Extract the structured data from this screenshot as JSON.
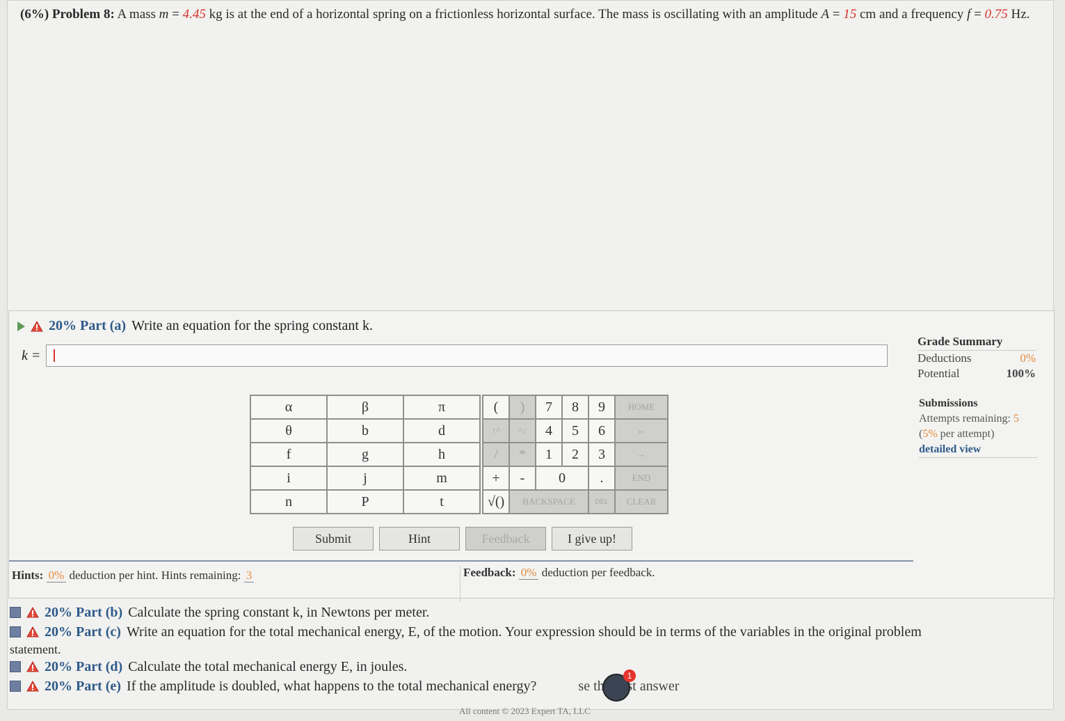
{
  "problem": {
    "prefix": "(6%) Problem 8:",
    "text1": " A mass ",
    "m_var": "m",
    "eq1": " = ",
    "m_val": "4.45",
    "text2": " kg is at the end of a horizontal spring on a frictionless horizontal surface. The mass is oscillating with an amplitude ",
    "A_var": "A",
    "eq2": " = ",
    "A_val": "15",
    "text3": " cm and a frequency ",
    "f_var": "f",
    "eq3": " = ",
    "f_val": "0.75",
    "text4": " Hz."
  },
  "part_a": {
    "pct": "20% Part (a)",
    "text": "Write an equation for the spring constant k.",
    "input_label": "k ="
  },
  "grade_summary": {
    "title": "Grade Summary",
    "deductions_label": "Deductions",
    "deductions_value": "0%",
    "potential_label": "Potential",
    "potential_value": "100%"
  },
  "submissions": {
    "title": "Submissions",
    "attempts_label": "Attempts remaining:",
    "attempts_value": "5",
    "per_attempt_pct": "5%",
    "per_attempt_text": "per attempt)",
    "detailed_view": "detailed view"
  },
  "symbols": [
    [
      "α",
      "β",
      "π"
    ],
    [
      "θ",
      "b",
      "d"
    ],
    [
      "f",
      "g",
      "h"
    ],
    [
      "i",
      "j",
      "m"
    ],
    [
      "n",
      "P",
      "t"
    ]
  ],
  "keypad": {
    "r1": [
      "(",
      ")",
      "7",
      "8",
      "9",
      "HOME"
    ],
    "r2": [
      "↑^",
      "^↓",
      "4",
      "5",
      "6",
      "←"
    ],
    "r3": [
      "/",
      "*",
      "1",
      "2",
      "3",
      "→"
    ],
    "r4": [
      "+",
      "-",
      "0",
      ".",
      "END"
    ],
    "r5": [
      "√()",
      "BACKSPACE",
      "DEL",
      "CLEAR"
    ]
  },
  "buttons": {
    "submit": "Submit",
    "hint": "Hint",
    "feedback": "Feedback",
    "give_up": "I give up!"
  },
  "hints": {
    "label": "Hints:",
    "pct": "0%",
    "text": "deduction per hint. Hints remaining:",
    "remaining": "3"
  },
  "feedback": {
    "label": "Feedback:",
    "pct": "0%",
    "text": "deduction per feedback."
  },
  "other_parts": [
    {
      "pct": "20% Part (b)",
      "text": "Calculate the spring constant k, in Newtons per meter."
    },
    {
      "pct": "20% Part (c)",
      "text": "Write an equation for the total mechanical energy, E, of the motion. Your expression should be in terms of the variables in the original problem"
    },
    {
      "pct": "20% Part (d)",
      "text": "Calculate the total mechanical energy E, in joules."
    },
    {
      "pct": "20% Part (e)",
      "text": "If the amplitude is doubled, what happens to the total mechanical energy?"
    }
  ],
  "part_c_cont": "statement.",
  "part_e_tail": "se the best answer",
  "avatar_badge": "1",
  "footer": "All content © 2023 Expert TA, LLC"
}
